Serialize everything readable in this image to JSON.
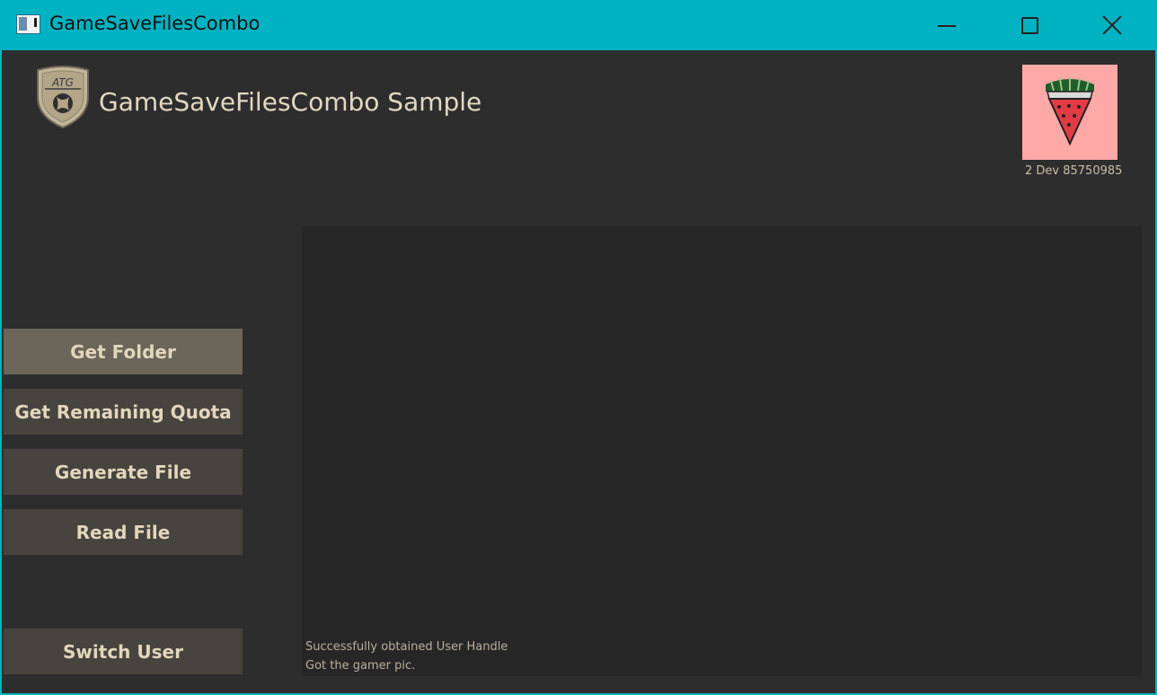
{
  "window": {
    "title": "GameSaveFilesCombo",
    "accent_color": "#00b2c2",
    "controls": {
      "minimize_icon": "minimize-icon",
      "maximize_icon": "maximize-icon",
      "close_icon": "close-icon"
    }
  },
  "header": {
    "logo_text": "ATG",
    "logo_icon": "xbox-logo-icon",
    "title": "GameSaveFilesCombo Sample"
  },
  "user": {
    "gamerpic_icon": "watermelon-icon",
    "gamerpic_background": "#ffa8a8",
    "gamertag": "2 Dev 85750985"
  },
  "actions": {
    "get_folder": "Get Folder",
    "get_remaining_quota": "Get Remaining Quota",
    "generate_file": "Generate File",
    "read_file": "Read File",
    "switch_user": "Switch User",
    "focused": "get_folder"
  },
  "log": {
    "lines": [
      "Successfully obtained User Handle",
      "Got the gamer pic."
    ]
  }
}
